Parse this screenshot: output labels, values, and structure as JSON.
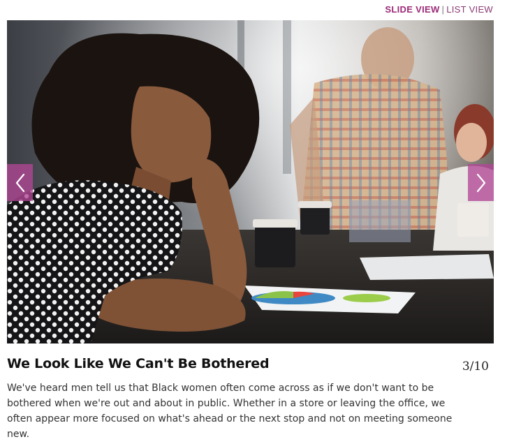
{
  "view_toggle": {
    "slide_view_label": "SLIDE VIEW",
    "separator": "|",
    "list_view_label": "LIST VIEW"
  },
  "slide": {
    "title": "We Look Like We Can't Be Bothered",
    "counter": "3/10",
    "body": "We've heard men tell us that Black women often come across as if we don't want to be bothered when we're out and about in public. Whether in a store or leaving the office, we often appear more focused on what's ahead or the next stop and not on meeting someone new."
  },
  "navigation": {
    "prev_icon": "chevron-left-icon",
    "next_icon": "chevron-right-icon"
  },
  "colors": {
    "accent": "#9b2a78",
    "arrow_bg": "#b24696"
  }
}
